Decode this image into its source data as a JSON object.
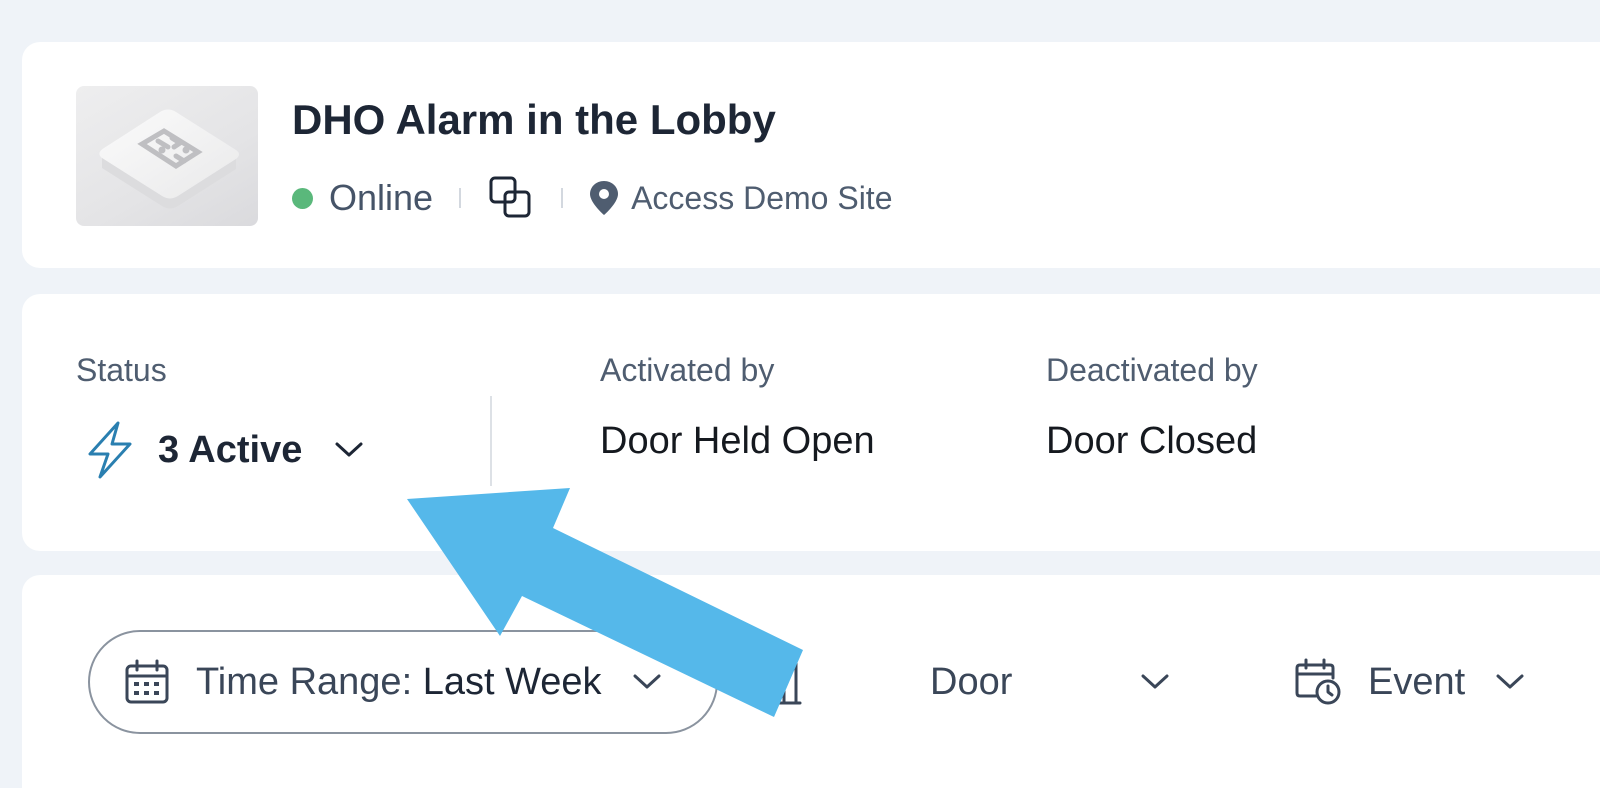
{
  "device": {
    "name": "DHO Alarm in the Lobby",
    "status": "Online",
    "site": "Access Demo Site",
    "status_color": "#5ab87b"
  },
  "alarm": {
    "status_label": "Status",
    "status_value": "3 Active",
    "activated_label": "Activated by",
    "activated_value": "Door Held Open",
    "deactivated_label": "Deactivated by",
    "deactivated_value": "Door Closed"
  },
  "filters": {
    "time_range_prefix": "Time Range:",
    "time_range_value": "Last Week",
    "door_label": "Door",
    "event_label": "Event"
  },
  "colors": {
    "accent": "#2a7fb0",
    "arrow": "#55b8ea",
    "background": "#eff3f8"
  },
  "icons": [
    "device-thumbnail",
    "status-dot",
    "copy-icon",
    "location-pin-icon",
    "lightning-bolt-icon",
    "chevron-down-icon",
    "calendar-icon",
    "door-icon",
    "calendar-clock-icon"
  ]
}
